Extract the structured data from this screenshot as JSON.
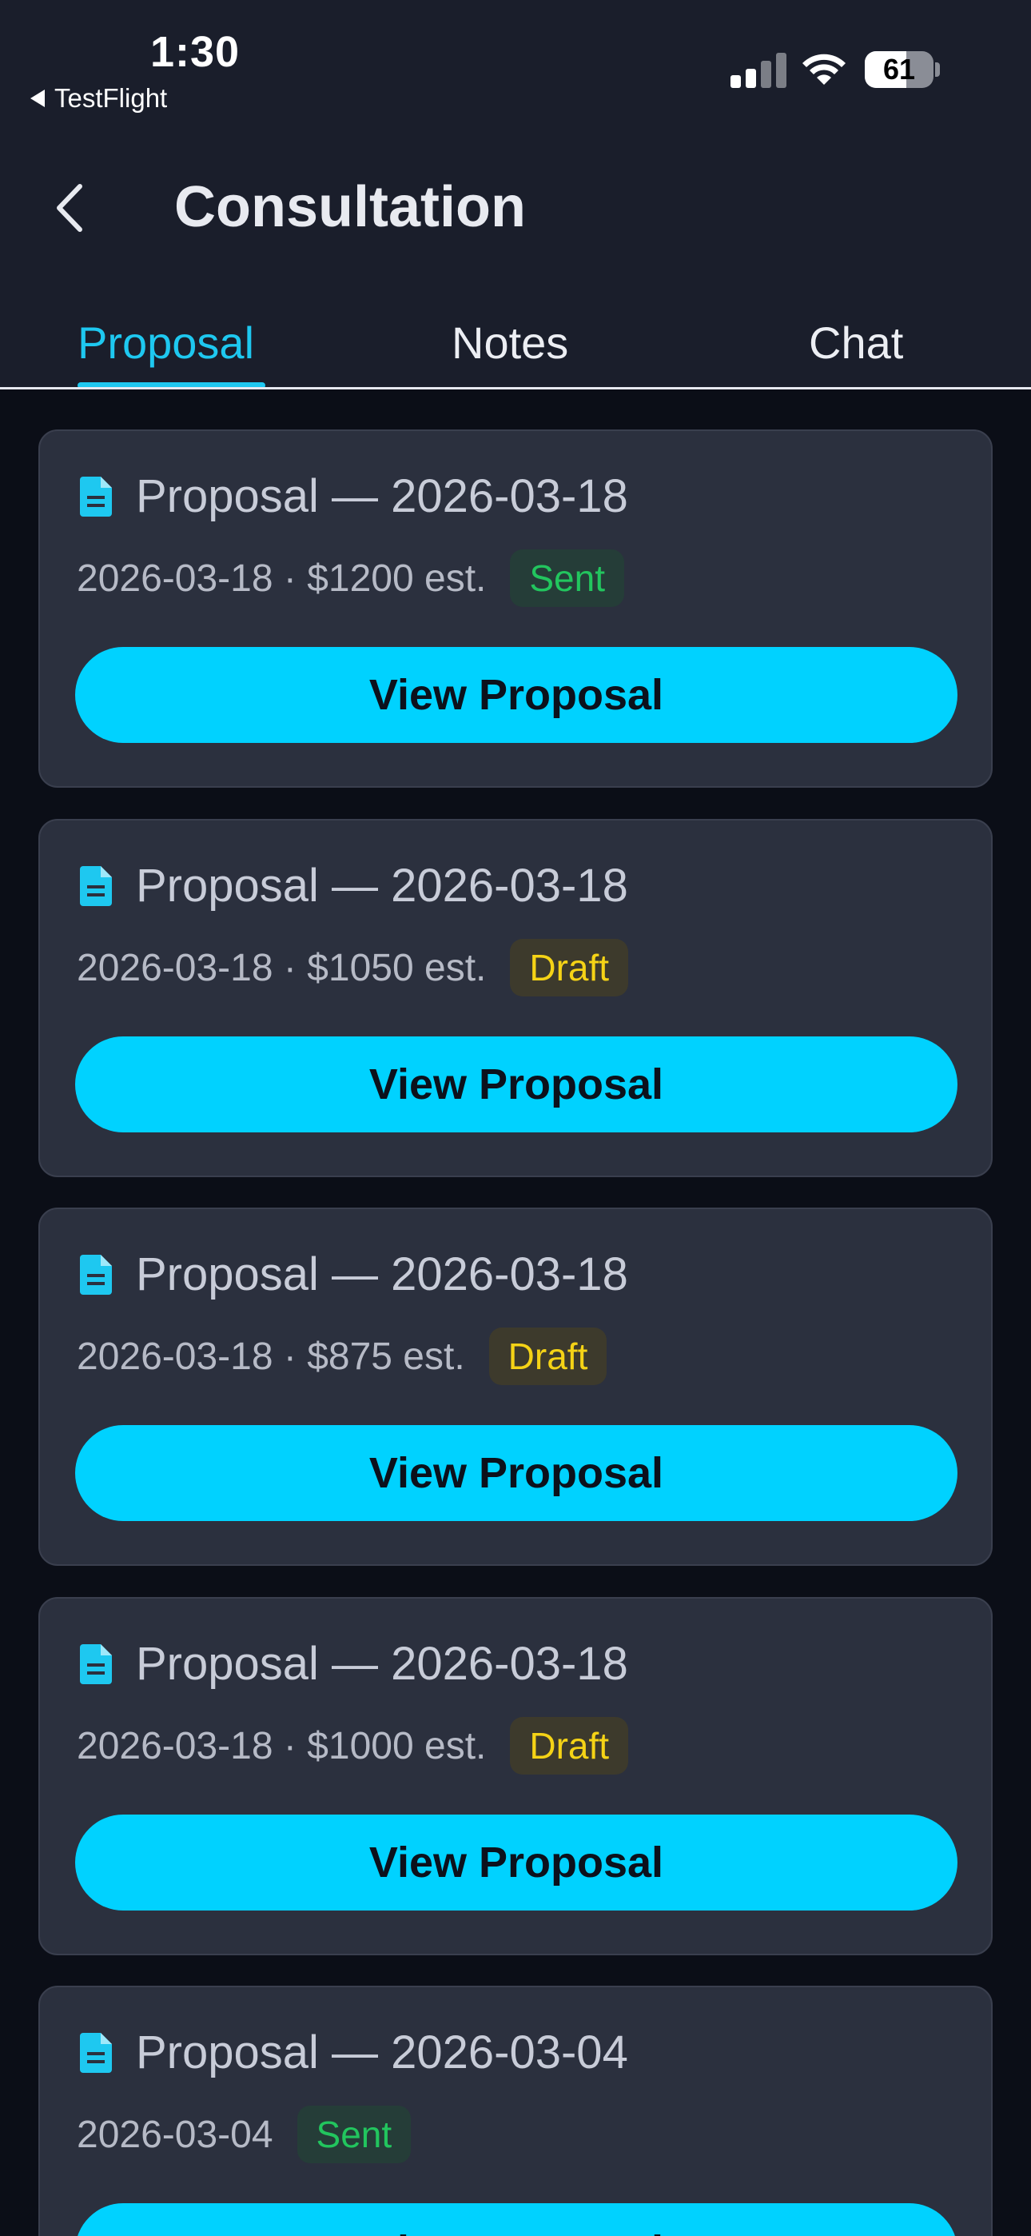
{
  "status_bar": {
    "time": "1:30",
    "back_app": "TestFlight",
    "battery": "61"
  },
  "header": {
    "title": "Consultation"
  },
  "tabs": [
    {
      "label": "Proposal",
      "active": true
    },
    {
      "label": "Notes",
      "active": false
    },
    {
      "label": "Chat",
      "active": false
    }
  ],
  "colors": {
    "accent": "#00d2ff",
    "sent": "#22c55e",
    "draft": "#f5d316"
  },
  "proposals": [
    {
      "title": "Proposal — 2026-03-18",
      "meta": "2026-03-18 · $1200 est.",
      "status": "Sent",
      "button": "View Proposal"
    },
    {
      "title": "Proposal — 2026-03-18",
      "meta": "2026-03-18 · $1050 est.",
      "status": "Draft",
      "button": "View Proposal"
    },
    {
      "title": "Proposal — 2026-03-18",
      "meta": "2026-03-18 · $875 est.",
      "status": "Draft",
      "button": "View Proposal"
    },
    {
      "title": "Proposal — 2026-03-18",
      "meta": "2026-03-18 · $1000 est.",
      "status": "Draft",
      "button": "View Proposal"
    },
    {
      "title": "Proposal — 2026-03-04",
      "meta": "2026-03-04",
      "status": "Sent",
      "button": "View Proposal"
    }
  ]
}
